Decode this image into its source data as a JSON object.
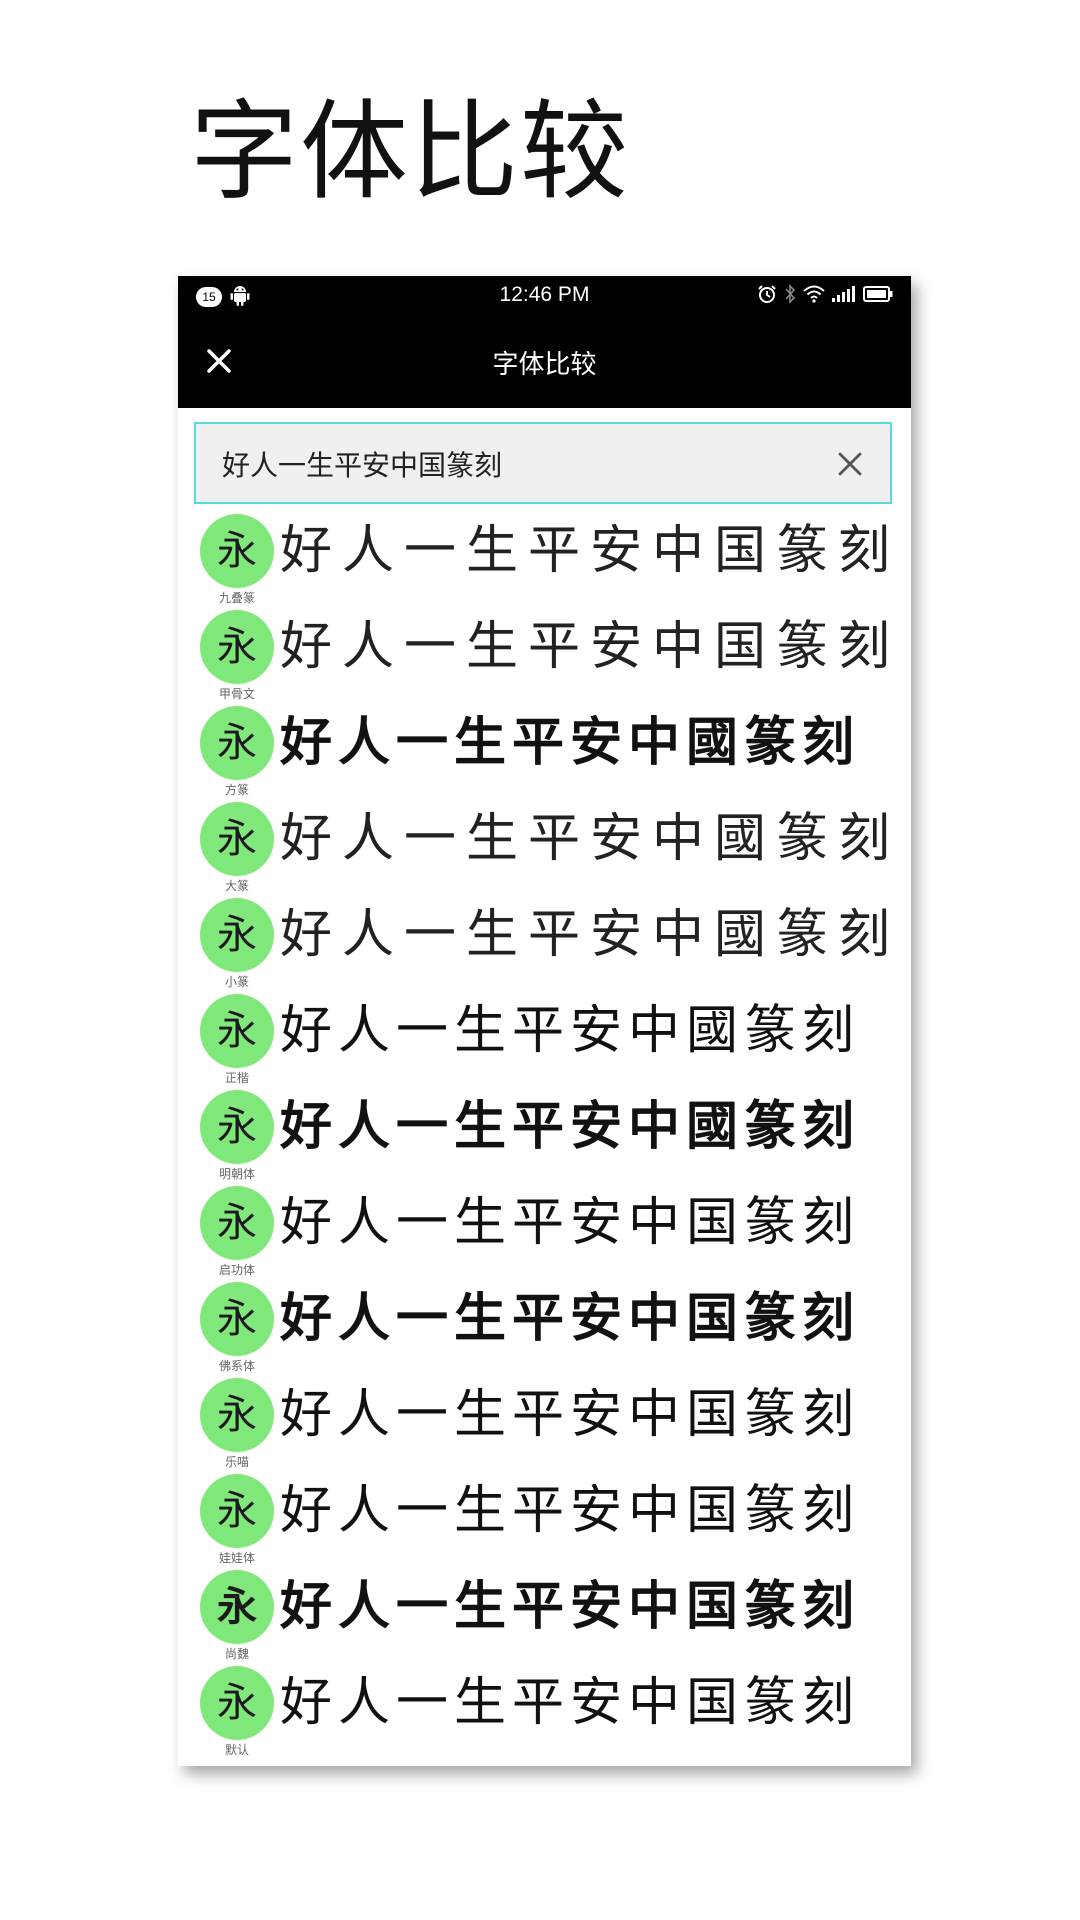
{
  "page_title": "字体比较",
  "status_bar": {
    "notification_count": "15",
    "time": "12:46 PM"
  },
  "app_bar": {
    "title": "字体比较"
  },
  "search": {
    "value": "好人一生平安中国篆刻"
  },
  "fonts": [
    {
      "badge": "永",
      "name": "九叠篆",
      "sample": "好人一生平安中国篆刻"
    },
    {
      "badge": "永",
      "name": "甲骨文",
      "sample": "好人一生平安中国篆刻"
    },
    {
      "badge": "永",
      "name": "方篆",
      "sample": "好人一生平安中國篆刻"
    },
    {
      "badge": "永",
      "name": "大篆",
      "sample": "好人一生平安中國篆刻"
    },
    {
      "badge": "永",
      "name": "小篆",
      "sample": "好人一生平安中國篆刻"
    },
    {
      "badge": "永",
      "name": "正楷",
      "sample": "好人一生平安中國篆刻"
    },
    {
      "badge": "永",
      "name": "明朝体",
      "sample": "好人一生平安中國篆刻"
    },
    {
      "badge": "永",
      "name": "启功体",
      "sample": "好人一生平安中国篆刻"
    },
    {
      "badge": "永",
      "name": "佛系体",
      "sample": "好人一生平安中国篆刻"
    },
    {
      "badge": "永",
      "name": "乐喵",
      "sample": "好人一生平安中国篆刻"
    },
    {
      "badge": "永",
      "name": "娃娃体",
      "sample": "好人一生平安中国篆刻"
    },
    {
      "badge": "永",
      "name": "尚魏",
      "sample": "好人一生平安中国篆刻"
    },
    {
      "badge": "永",
      "name": "默认",
      "sample": "好人一生平安中国篆刻"
    }
  ],
  "colors": {
    "badge_green": "#80e87a",
    "search_border": "#56dcdc",
    "bar_black": "#000000"
  }
}
